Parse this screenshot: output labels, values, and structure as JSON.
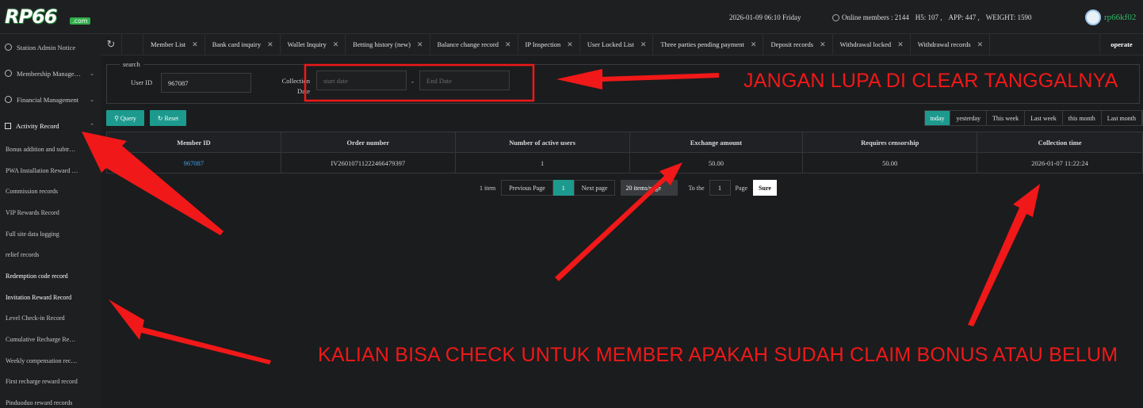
{
  "header": {
    "logo_text": "RP66",
    "logo_suffix": ".com",
    "datetime": "2026-01-09 06:10 Friday",
    "online_label": "Online members : 2144",
    "h5_label": "H5: 107 ,",
    "app_label": "APP: 447 ,",
    "weight_label": "WEIGHT: 1590",
    "username": "rp66kf02"
  },
  "sidebar": {
    "groups": [
      {
        "label": "Station Admin Notice"
      },
      {
        "label": "Membership Manage…"
      },
      {
        "label": "Financial Management"
      },
      {
        "label": "Activity Record"
      }
    ],
    "items": [
      {
        "label": "Bonus addition and subtr…"
      },
      {
        "label": "PWA Installation Reward …"
      },
      {
        "label": "Commission records"
      },
      {
        "label": "VIP Rewards Record"
      },
      {
        "label": "Full site data logging"
      },
      {
        "label": "relief records"
      },
      {
        "label": "Redemption code record"
      },
      {
        "label": "Invitation Reward Record"
      },
      {
        "label": "Level Check-in Record"
      },
      {
        "label": "Cumulative Recharge Re…"
      },
      {
        "label": "Weekly compensation rec…"
      },
      {
        "label": "First recharge reward record"
      },
      {
        "label": "Pinduoduo reward records"
      }
    ]
  },
  "tabs": [
    {
      "label": "Member List"
    },
    {
      "label": "Bank card inquiry"
    },
    {
      "label": "Wallet Inquiry"
    },
    {
      "label": "Betting history (new)"
    },
    {
      "label": "Balance change record"
    },
    {
      "label": "IP Inspection"
    },
    {
      "label": "User Locked List"
    },
    {
      "label": "Three parties pending payment"
    },
    {
      "label": "Deposit records"
    },
    {
      "label": "Withdrawal locked"
    },
    {
      "label": "Withdrawal records"
    }
  ],
  "tab_operate": "operate",
  "search": {
    "legend": "search",
    "user_id_label": "User ID",
    "user_id_value": "967087",
    "collection_label_1": "Collection",
    "collection_label_2": "Date",
    "start_placeholder": "start date",
    "end_placeholder": "End Date",
    "dash": "-"
  },
  "actions": {
    "query": "Query",
    "reset": "Reset"
  },
  "quick_ranges": [
    "today",
    "yesterday",
    "This week",
    "Last week",
    "this month",
    "Last month"
  ],
  "table": {
    "headers": [
      "Member ID",
      "Order number",
      "Number of active users",
      "Exchange amount",
      "Requires censorship",
      "Collection time"
    ],
    "rows": [
      [
        "967087",
        "IV26010711222466479397",
        "1",
        "50.00",
        "50.00",
        "2026-01-07 11:22:24"
      ]
    ]
  },
  "pagination": {
    "total": "1 item",
    "prev": "Previous Page",
    "current": "1",
    "next": "Next page",
    "page_size": "20 items/page",
    "goto_label": "To the",
    "goto_value": "1",
    "page_label": "Page",
    "confirm": "Sure"
  },
  "annotations": {
    "top": "JANGAN LUPA DI CLEAR TANGGALNYA",
    "bottom": "KALIAN BISA CHECK UNTUK MEMBER APAKAH SUDAH CLAIM BONUS ATAU BELUM",
    "color": "#f01818"
  },
  "colors": {
    "accent": "#1d9a8e",
    "link": "#3fa3e8",
    "username": "#2fb864"
  }
}
